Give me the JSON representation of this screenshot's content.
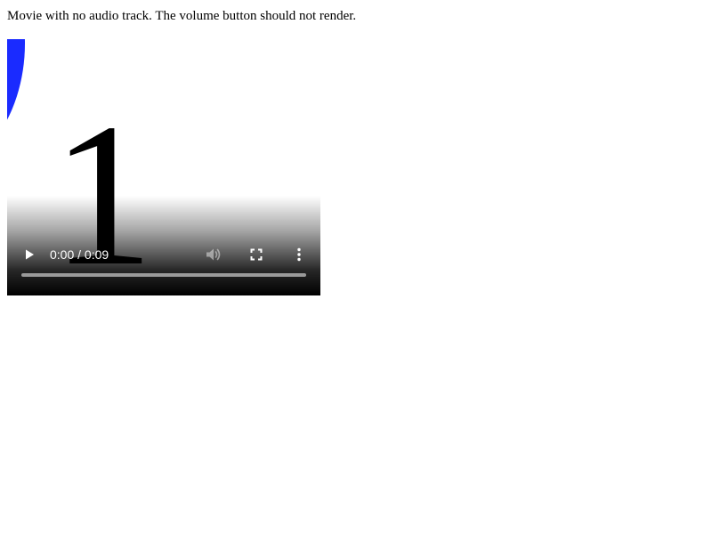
{
  "page": {
    "caption": "Movie with no audio track. The volume button should not render."
  },
  "video": {
    "frame_digit": "1",
    "circle_color": "#1a2bff",
    "time_display": "0:00 / 0:09",
    "progress": 0,
    "icons": {
      "play": "play-icon",
      "volume": "volume-icon",
      "fullscreen": "fullscreen-icon",
      "more": "more-vertical-icon"
    }
  }
}
